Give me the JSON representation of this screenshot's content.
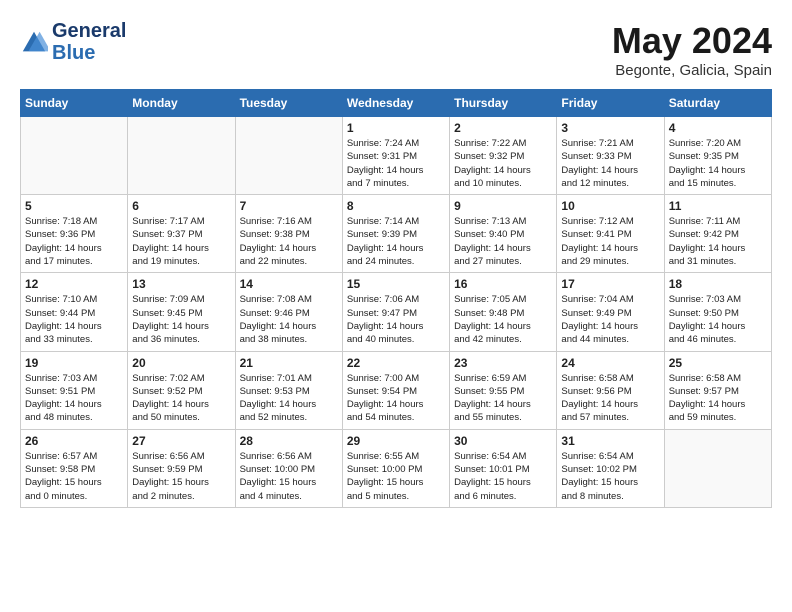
{
  "header": {
    "logo_general": "General",
    "logo_blue": "Blue",
    "month_title": "May 2024",
    "location": "Begonte, Galicia, Spain"
  },
  "weekdays": [
    "Sunday",
    "Monday",
    "Tuesday",
    "Wednesday",
    "Thursday",
    "Friday",
    "Saturday"
  ],
  "weeks": [
    [
      {
        "day": "",
        "info": ""
      },
      {
        "day": "",
        "info": ""
      },
      {
        "day": "",
        "info": ""
      },
      {
        "day": "1",
        "info": "Sunrise: 7:24 AM\nSunset: 9:31 PM\nDaylight: 14 hours\nand 7 minutes."
      },
      {
        "day": "2",
        "info": "Sunrise: 7:22 AM\nSunset: 9:32 PM\nDaylight: 14 hours\nand 10 minutes."
      },
      {
        "day": "3",
        "info": "Sunrise: 7:21 AM\nSunset: 9:33 PM\nDaylight: 14 hours\nand 12 minutes."
      },
      {
        "day": "4",
        "info": "Sunrise: 7:20 AM\nSunset: 9:35 PM\nDaylight: 14 hours\nand 15 minutes."
      }
    ],
    [
      {
        "day": "5",
        "info": "Sunrise: 7:18 AM\nSunset: 9:36 PM\nDaylight: 14 hours\nand 17 minutes."
      },
      {
        "day": "6",
        "info": "Sunrise: 7:17 AM\nSunset: 9:37 PM\nDaylight: 14 hours\nand 19 minutes."
      },
      {
        "day": "7",
        "info": "Sunrise: 7:16 AM\nSunset: 9:38 PM\nDaylight: 14 hours\nand 22 minutes."
      },
      {
        "day": "8",
        "info": "Sunrise: 7:14 AM\nSunset: 9:39 PM\nDaylight: 14 hours\nand 24 minutes."
      },
      {
        "day": "9",
        "info": "Sunrise: 7:13 AM\nSunset: 9:40 PM\nDaylight: 14 hours\nand 27 minutes."
      },
      {
        "day": "10",
        "info": "Sunrise: 7:12 AM\nSunset: 9:41 PM\nDaylight: 14 hours\nand 29 minutes."
      },
      {
        "day": "11",
        "info": "Sunrise: 7:11 AM\nSunset: 9:42 PM\nDaylight: 14 hours\nand 31 minutes."
      }
    ],
    [
      {
        "day": "12",
        "info": "Sunrise: 7:10 AM\nSunset: 9:44 PM\nDaylight: 14 hours\nand 33 minutes."
      },
      {
        "day": "13",
        "info": "Sunrise: 7:09 AM\nSunset: 9:45 PM\nDaylight: 14 hours\nand 36 minutes."
      },
      {
        "day": "14",
        "info": "Sunrise: 7:08 AM\nSunset: 9:46 PM\nDaylight: 14 hours\nand 38 minutes."
      },
      {
        "day": "15",
        "info": "Sunrise: 7:06 AM\nSunset: 9:47 PM\nDaylight: 14 hours\nand 40 minutes."
      },
      {
        "day": "16",
        "info": "Sunrise: 7:05 AM\nSunset: 9:48 PM\nDaylight: 14 hours\nand 42 minutes."
      },
      {
        "day": "17",
        "info": "Sunrise: 7:04 AM\nSunset: 9:49 PM\nDaylight: 14 hours\nand 44 minutes."
      },
      {
        "day": "18",
        "info": "Sunrise: 7:03 AM\nSunset: 9:50 PM\nDaylight: 14 hours\nand 46 minutes."
      }
    ],
    [
      {
        "day": "19",
        "info": "Sunrise: 7:03 AM\nSunset: 9:51 PM\nDaylight: 14 hours\nand 48 minutes."
      },
      {
        "day": "20",
        "info": "Sunrise: 7:02 AM\nSunset: 9:52 PM\nDaylight: 14 hours\nand 50 minutes."
      },
      {
        "day": "21",
        "info": "Sunrise: 7:01 AM\nSunset: 9:53 PM\nDaylight: 14 hours\nand 52 minutes."
      },
      {
        "day": "22",
        "info": "Sunrise: 7:00 AM\nSunset: 9:54 PM\nDaylight: 14 hours\nand 54 minutes."
      },
      {
        "day": "23",
        "info": "Sunrise: 6:59 AM\nSunset: 9:55 PM\nDaylight: 14 hours\nand 55 minutes."
      },
      {
        "day": "24",
        "info": "Sunrise: 6:58 AM\nSunset: 9:56 PM\nDaylight: 14 hours\nand 57 minutes."
      },
      {
        "day": "25",
        "info": "Sunrise: 6:58 AM\nSunset: 9:57 PM\nDaylight: 14 hours\nand 59 minutes."
      }
    ],
    [
      {
        "day": "26",
        "info": "Sunrise: 6:57 AM\nSunset: 9:58 PM\nDaylight: 15 hours\nand 0 minutes."
      },
      {
        "day": "27",
        "info": "Sunrise: 6:56 AM\nSunset: 9:59 PM\nDaylight: 15 hours\nand 2 minutes."
      },
      {
        "day": "28",
        "info": "Sunrise: 6:56 AM\nSunset: 10:00 PM\nDaylight: 15 hours\nand 4 minutes."
      },
      {
        "day": "29",
        "info": "Sunrise: 6:55 AM\nSunset: 10:00 PM\nDaylight: 15 hours\nand 5 minutes."
      },
      {
        "day": "30",
        "info": "Sunrise: 6:54 AM\nSunset: 10:01 PM\nDaylight: 15 hours\nand 6 minutes."
      },
      {
        "day": "31",
        "info": "Sunrise: 6:54 AM\nSunset: 10:02 PM\nDaylight: 15 hours\nand 8 minutes."
      },
      {
        "day": "",
        "info": ""
      }
    ]
  ]
}
